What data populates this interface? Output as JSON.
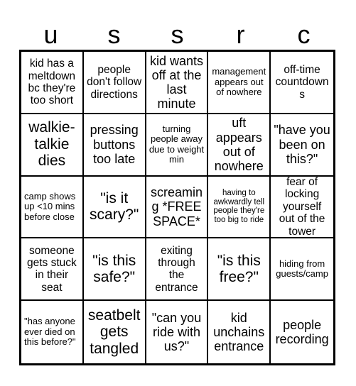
{
  "card": {
    "header_letters": [
      "u",
      "s",
      "s",
      "r",
      "c"
    ],
    "rows": [
      [
        {
          "text": "kid has a meltdown bc they're too short",
          "size": "s-md",
          "align": "center"
        },
        {
          "text": "people don't follow directions",
          "size": "s-md",
          "align": "center"
        },
        {
          "text": "kid wants off at the last minute",
          "size": "s-lg",
          "align": "center"
        },
        {
          "text": "management appears out of nowhere",
          "size": "s-sm",
          "align": "center"
        },
        {
          "text": "off-time countdowns",
          "size": "s-md",
          "align": "center"
        }
      ],
      [
        {
          "text": "walkie-talkie dies",
          "size": "s-xl",
          "align": "center"
        },
        {
          "text": "pressing buttons too late",
          "size": "s-lg",
          "align": "center"
        },
        {
          "text": "turning people away due to weight min",
          "size": "s-sm",
          "align": "center"
        },
        {
          "text": "uft appears out of nowhere",
          "size": "s-lg",
          "align": "center"
        },
        {
          "text": "\"have you been on this?\"",
          "size": "s-lg",
          "align": "center"
        }
      ],
      [
        {
          "text": "camp shows up <10 mins before close",
          "size": "s-sm",
          "align": "left"
        },
        {
          "text": "\"is it scary?\"",
          "size": "s-xl",
          "align": "center"
        },
        {
          "text": "screaming *FREE SPACE*",
          "size": "s-lg",
          "align": "center"
        },
        {
          "text": "having to awkwardly tell people they're too big to ride",
          "size": "s-xs",
          "align": "center"
        },
        {
          "text": "fear of locking yourself out of the tower",
          "size": "s-md",
          "align": "center"
        }
      ],
      [
        {
          "text": "someone gets stuck in their seat",
          "size": "s-md",
          "align": "center"
        },
        {
          "text": "\"is this safe?\"",
          "size": "s-xl",
          "align": "center"
        },
        {
          "text": "exiting through the entrance",
          "size": "s-md",
          "align": "center"
        },
        {
          "text": "\"is this free?\"",
          "size": "s-xl",
          "align": "center"
        },
        {
          "text": "hiding from guests/camp",
          "size": "s-sm",
          "align": "center"
        }
      ],
      [
        {
          "text": "\"has anyone ever died on this before?\"",
          "size": "s-sm",
          "align": "left"
        },
        {
          "text": "seatbelt gets tangled",
          "size": "s-xl",
          "align": "center"
        },
        {
          "text": "\"can you ride with us?\"",
          "size": "s-lg",
          "align": "center"
        },
        {
          "text": "kid unchains entrance",
          "size": "s-lg",
          "align": "center"
        },
        {
          "text": "people recording",
          "size": "s-lg",
          "align": "center"
        }
      ]
    ]
  },
  "colors": {
    "border": "#000000",
    "background": "#ffffff",
    "text": "#000000"
  }
}
